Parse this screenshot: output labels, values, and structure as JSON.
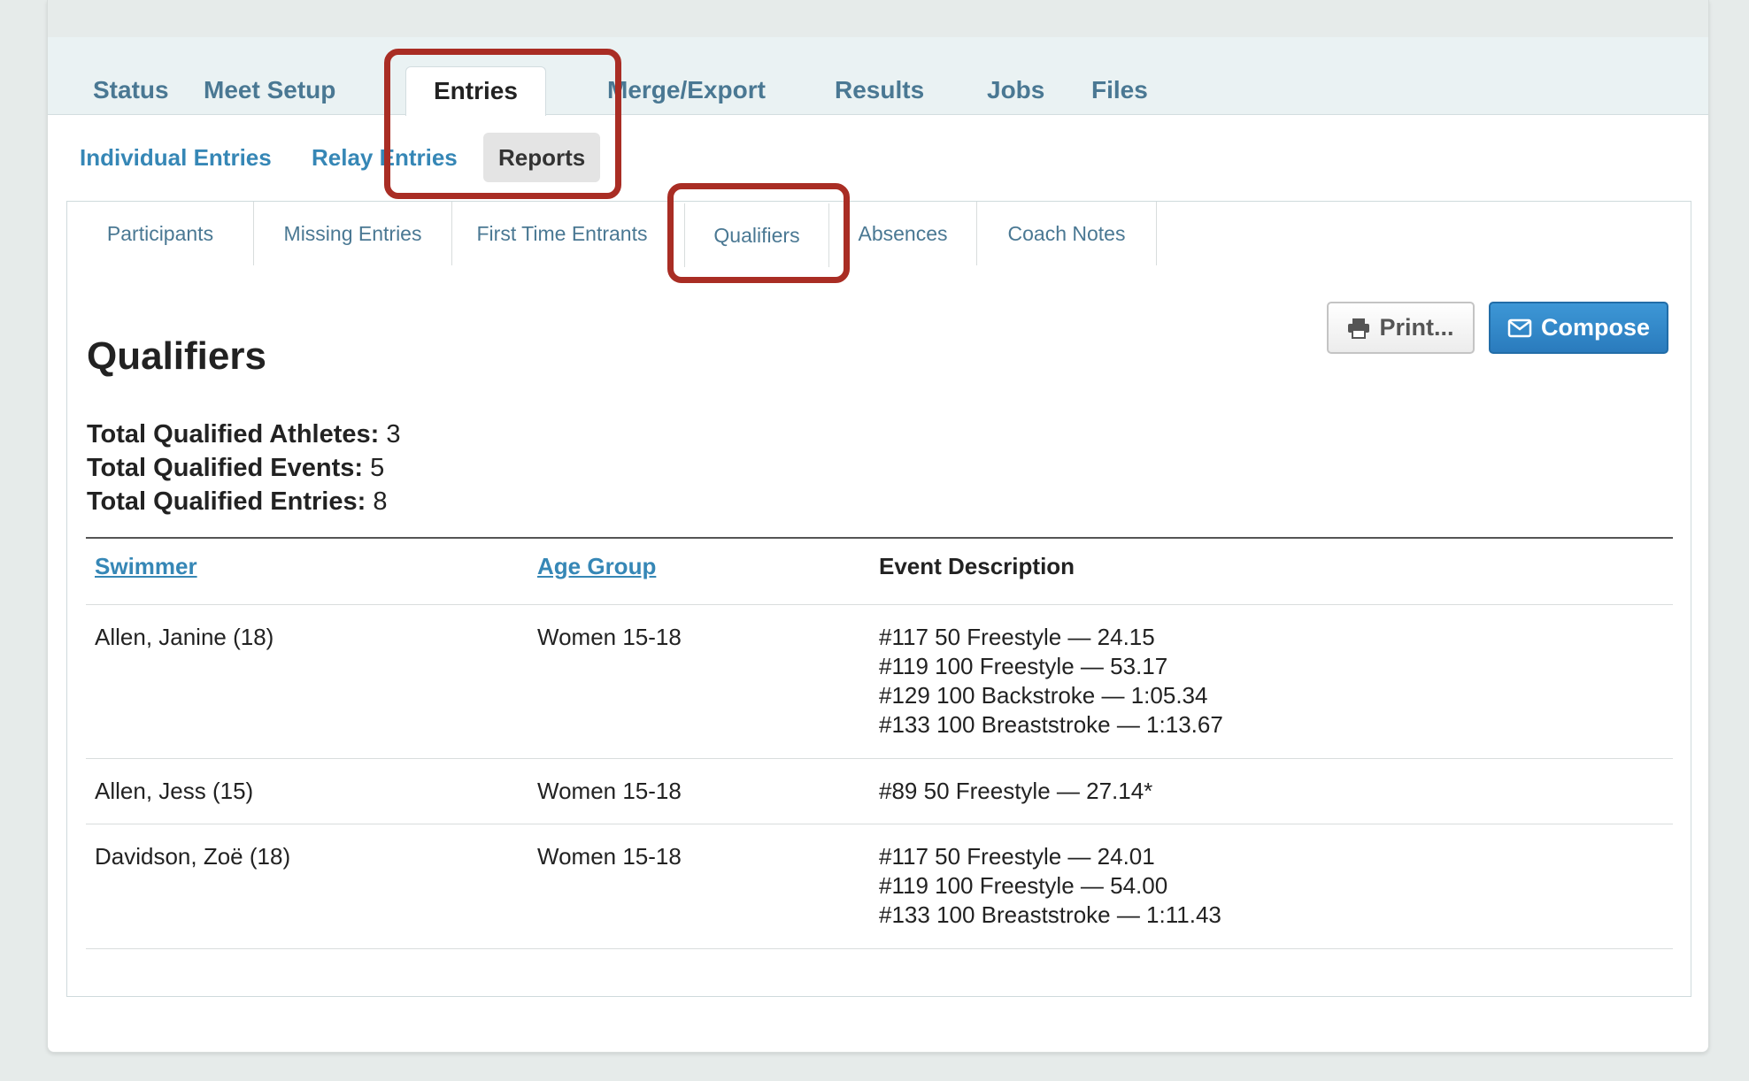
{
  "main_tabs": [
    {
      "label": "Status"
    },
    {
      "label": "Meet Setup"
    },
    {
      "label": "Entries",
      "active": true
    },
    {
      "label": "Merge/Export"
    },
    {
      "label": "Results"
    },
    {
      "label": "Jobs"
    },
    {
      "label": "Files"
    }
  ],
  "sub_tabs": [
    {
      "label": "Individual Entries"
    },
    {
      "label": "Relay Entries"
    },
    {
      "label": "Reports",
      "active": true
    }
  ],
  "report_tabs": [
    {
      "label": "Participants"
    },
    {
      "label": "Missing Entries"
    },
    {
      "label": "First Time Entrants"
    },
    {
      "label": "Qualifiers",
      "active": true
    },
    {
      "label": "Absences"
    },
    {
      "label": "Coach Notes"
    }
  ],
  "page_title": "Qualifiers",
  "buttons": {
    "print_label": "Print...",
    "compose_label": "Compose"
  },
  "icons": {
    "print": "printer-icon",
    "compose": "envelope-icon"
  },
  "stats": {
    "athletes_label": "Total Qualified Athletes:",
    "athletes_value": "3",
    "events_label": "Total Qualified Events:",
    "events_value": "5",
    "entries_label": "Total Qualified Entries:",
    "entries_value": "8"
  },
  "table": {
    "headers": {
      "swimmer": "Swimmer",
      "age_group": "Age Group",
      "event_description": "Event Description"
    },
    "rows": [
      {
        "swimmer": "Allen, Janine (18)",
        "age_group": "Women 15-18",
        "events": [
          "#117 50 Freestyle  —  24.15",
          "#119 100 Freestyle  —  53.17",
          "#129 100 Backstroke  —  1:05.34",
          "#133 100 Breaststroke  —  1:13.67"
        ]
      },
      {
        "swimmer": "Allen, Jess (15)",
        "age_group": "Women 15-18",
        "events": [
          "#89 50 Freestyle  —  27.14*"
        ]
      },
      {
        "swimmer": "Davidson, Zoë (18)",
        "age_group": "Women 15-18",
        "events": [
          "#117 50 Freestyle  —  24.01",
          "#119 100 Freestyle  —  54.00",
          "#133 100 Breaststroke  —  1:11.43"
        ]
      }
    ]
  },
  "colors": {
    "link": "#3687b6",
    "nav_text": "#4a7893",
    "highlight": "#a92d24",
    "compose_bg": "#2a7bbd"
  }
}
